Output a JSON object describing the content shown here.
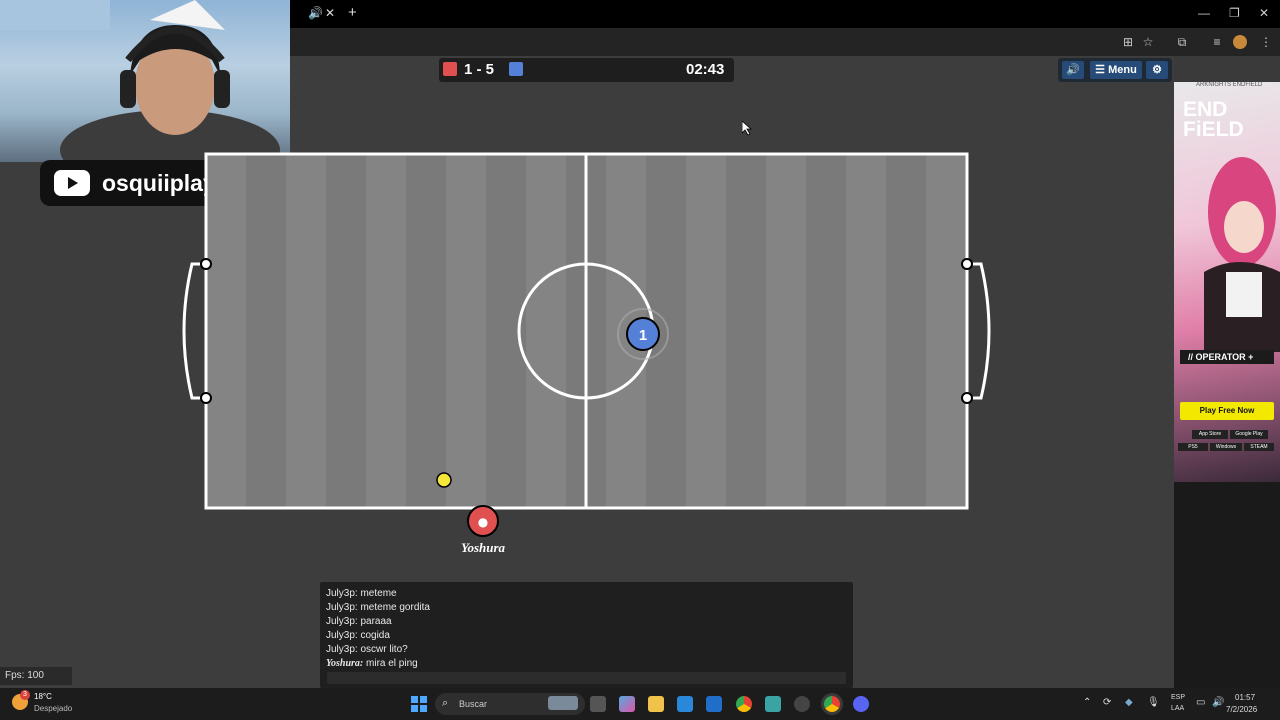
{
  "browser": {
    "tab_sound_glyph": "🔊",
    "tab_close_glyph": "✕",
    "new_tab_glyph": "+",
    "window_controls": [
      "—",
      "❐",
      "✕"
    ],
    "toolbar_icons": [
      "translate-icon",
      "star-icon",
      "extensions-icon",
      "media-icon",
      "profile-icon",
      "kebab-menu-icon"
    ]
  },
  "overlay": {
    "channel_name": "osquiiplay"
  },
  "scoreboard": {
    "red_color": "#e05050",
    "blue_color": "#5580d8",
    "score": "1 - 5",
    "timer": "02:43"
  },
  "header_buttons": {
    "sound_glyph": "🔊",
    "menu_label": "☰ Menu",
    "settings_glyph": "⚙"
  },
  "field": {
    "blue_player_number": "1",
    "red_player_name": "Yoshura",
    "line_color": "#ffffff",
    "ball_color": "#f5e63a"
  },
  "chat": {
    "messages": [
      {
        "text": "July3p: meteme"
      },
      {
        "text": "July3p: meteme gordita"
      },
      {
        "text": "July3p: paraaa"
      },
      {
        "text": "July3p: cogida"
      },
      {
        "text": "July3p: oscwr lito?"
      },
      {
        "author": "Yoshura:",
        "text": " mira el ping"
      }
    ]
  },
  "fps": "Fps: 100",
  "ad": {
    "brand_small": "ARKNIGHTS ENDFIELD",
    "brand_big_1": "END",
    "brand_big_2": "FiELD",
    "tag": "// OPERATOR +",
    "cta": "Play Free Now",
    "store_1": "App Store",
    "store_2": "Google Play",
    "plat_1": "PS5",
    "plat_2": "Windows",
    "plat_3": "STEAM"
  },
  "taskbar": {
    "temp": "18°C",
    "weather": "Despejado",
    "weather_badge": "3",
    "search_placeholder": "Buscar",
    "lang_1": "ESP",
    "lang_2": "LAA",
    "time": "01:57",
    "date": "7/2/2026"
  }
}
